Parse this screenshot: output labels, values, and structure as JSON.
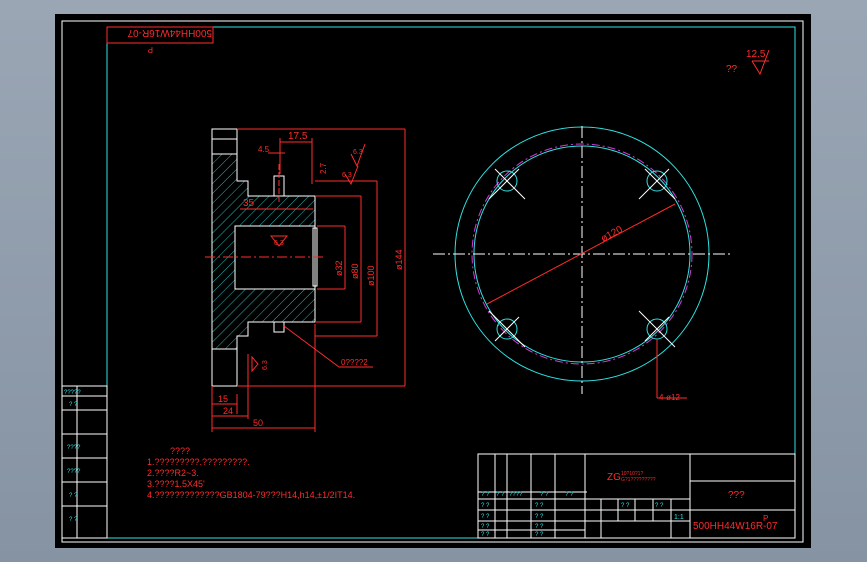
{
  "drawing": {
    "code_stamp": "500HH44W16R-07",
    "code_stamp_subscript": "P",
    "roughness_note": "??",
    "roughness_value": "12.5"
  },
  "section_view": {
    "dims": {
      "d17_5": "17.5",
      "d4_5": "4.5",
      "d2_7": "2.7",
      "d35": "35",
      "d32": "ø32",
      "d80": "ø80",
      "d100": "ø100",
      "d144": "ø144",
      "d15": "15",
      "d24": "24",
      "d50": "50",
      "r_a": "6.3",
      "r_b": "6.3",
      "r_c": "6.3",
      "r_d": "6.3",
      "leader_note": "0????2"
    }
  },
  "front_view": {
    "pcd_label": "ø120",
    "hole_label": "4-ø12"
  },
  "notes": {
    "heading": "????",
    "lines": [
      "1.?????????.?????????.",
      "2.????R2~3.",
      "3.????1.5X45'",
      "4.?????????????GB1804-79???H14,h14,±1/2IT14."
    ]
  },
  "left_strip": {
    "cells": [
      "?????",
      "?  ?",
      "????",
      "????",
      "?  ?",
      "?  ?"
    ]
  },
  "title_block": {
    "material": "ZG",
    "material_sub1": "10?10?1?",
    "material_sub2": "G?1?????????",
    "part_name": "???",
    "scale": "1:1",
    "drawing_no": "500HH44W16R-07",
    "drawing_no_sub": "P",
    "row_labels": [
      "? ?",
      "? ?",
      "? ?",
      "? ?"
    ],
    "header_cells": [
      "? ?",
      "? ?",
      "????",
      "? ?",
      "? ?",
      "? ?",
      "? ?"
    ]
  }
}
